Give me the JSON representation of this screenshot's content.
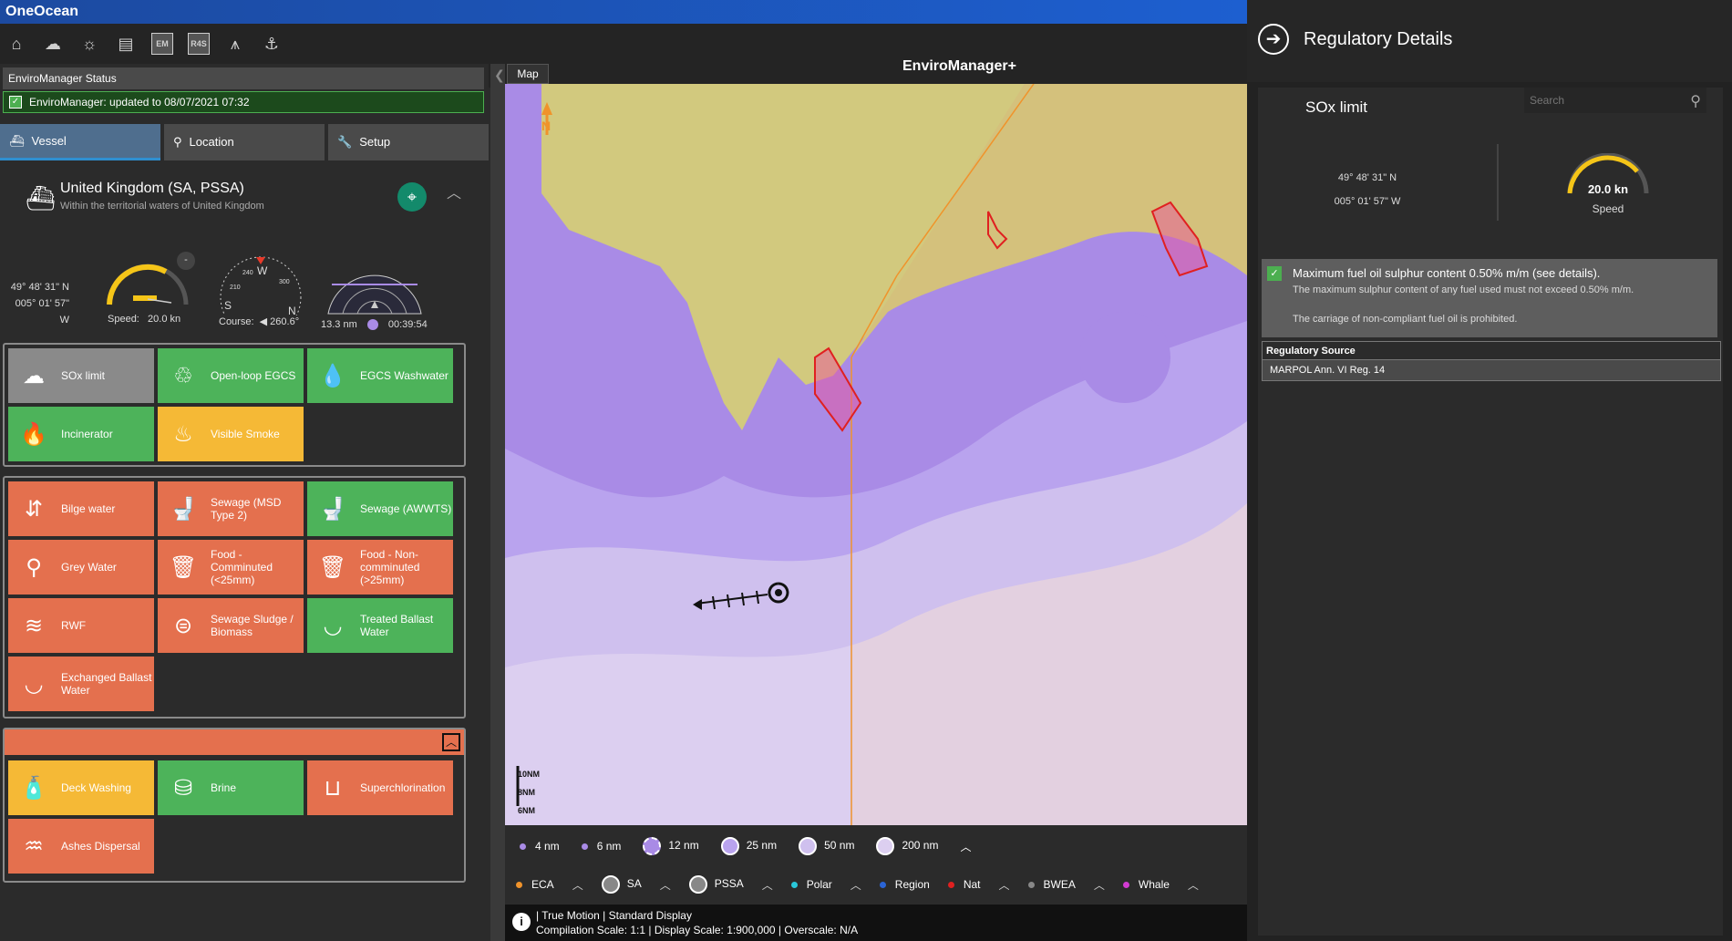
{
  "app_name": "OneOcean",
  "app_title": "EnviroManager+",
  "toolbar": {
    "icons": [
      "home-icon",
      "cloud-upload-icon",
      "weather-icon",
      "chart-icon",
      "em-icon",
      "r4s-icon",
      "compass-tool-icon",
      "anchor-icon"
    ],
    "em_label": "EM",
    "r4s_label": "R4S"
  },
  "status": {
    "header": "EnviroManager Status",
    "message": "EnviroManager: updated to 08/07/2021 07:32"
  },
  "tabs": [
    {
      "label": "Vessel"
    },
    {
      "label": "Location"
    },
    {
      "label": "Setup"
    }
  ],
  "location": {
    "name": "United Kingdom (SA, PSSA)",
    "subtitle": "Within the territorial waters of United Kingdom"
  },
  "position": {
    "lat": "49° 48' 31\" N",
    "lon": "005° 01' 57\" W"
  },
  "speed": {
    "label": "Speed:",
    "value": "20.0 kn",
    "minus": "-"
  },
  "course": {
    "label": "Course:",
    "value": "260.6°",
    "w": "W",
    "s": "S",
    "n": "N",
    "t240": "240",
    "t210": "210",
    "t300": "300"
  },
  "radar": {
    "distance": "13.3 nm",
    "time": "00:39:54"
  },
  "group1": [
    {
      "label": "SOx limit",
      "color": "gr",
      "icon": "sox-icon",
      "glyph": "☁"
    },
    {
      "label": "Open-loop EGCS",
      "color": "g",
      "icon": "egcs-icon",
      "glyph": "♲"
    },
    {
      "label": "EGCS Washwater",
      "color": "g",
      "icon": "drop-icon",
      "glyph": "💧"
    },
    {
      "label": "Incinerator",
      "color": "g",
      "icon": "flame-icon",
      "glyph": "🔥"
    },
    {
      "label": "Visible Smoke",
      "color": "y",
      "icon": "smoke-icon",
      "glyph": "♨"
    }
  ],
  "group2": [
    {
      "label": "Bilge water",
      "color": "o",
      "icon": "bilge-icon",
      "glyph": "⇵"
    },
    {
      "label": "Sewage (MSD Type 2)",
      "color": "o",
      "icon": "toilet-icon",
      "glyph": "🚽"
    },
    {
      "label": "Sewage (AWWTS)",
      "color": "g",
      "icon": "toilet-icon",
      "glyph": "🚽"
    },
    {
      "label": "Grey Water",
      "color": "o",
      "icon": "tap-icon",
      "glyph": "⚲"
    },
    {
      "label": "Food - Comminuted (<25mm)",
      "color": "o",
      "icon": "bin-icon",
      "glyph": "🗑"
    },
    {
      "label": "Food - Non-comminuted (>25mm)",
      "color": "o",
      "icon": "bin-icon",
      "glyph": "🗑"
    },
    {
      "label": "RWF",
      "color": "o",
      "icon": "waves-icon",
      "glyph": "≋"
    },
    {
      "label": "Sewage Sludge / Biomass",
      "color": "o",
      "icon": "sludge-icon",
      "glyph": "⊜"
    },
    {
      "label": "Treated Ballast Water",
      "color": "g",
      "icon": "ballast-icon",
      "glyph": "◡"
    },
    {
      "label": "Exchanged Ballast Water",
      "color": "o",
      "icon": "ballast-icon",
      "glyph": "◡"
    }
  ],
  "group3": [
    {
      "label": "Deck Washing",
      "color": "y",
      "icon": "deck-wash-icon",
      "glyph": "🧴"
    },
    {
      "label": "Brine",
      "color": "g",
      "icon": "brine-icon",
      "glyph": "⛁"
    },
    {
      "label": "Superchlorination",
      "color": "o",
      "icon": "pool-icon",
      "glyph": "⊔"
    },
    {
      "label": "Ashes Dispersal",
      "color": "o",
      "icon": "ashes-icon",
      "glyph": "♒"
    }
  ],
  "map": {
    "tab": "Map",
    "north": "N",
    "scale": [
      "10NM",
      "8NM",
      "6NM"
    ]
  },
  "legend1": [
    {
      "label": "4 nm"
    },
    {
      "label": "6 nm"
    },
    {
      "label": "12 nm"
    },
    {
      "label": "25 nm"
    },
    {
      "label": "50 nm"
    },
    {
      "label": "200 nm"
    }
  ],
  "legend2": [
    {
      "label": "ECA",
      "color": "#f0932b"
    },
    {
      "label": "SA",
      "color": "#888888"
    },
    {
      "label": "PSSA",
      "color": "#888888"
    },
    {
      "label": "Polar",
      "color": "#29c7d9"
    },
    {
      "label": "Region",
      "color": "#2a64d6"
    },
    {
      "label": "Nat",
      "color": "#e02020"
    },
    {
      "label": "BWEA",
      "color": "#888888"
    },
    {
      "label": "Whale",
      "color": "#d23bd2"
    }
  ],
  "info": {
    "line1": "| True Motion | Standard Display",
    "line2": "Compilation Scale: 1:1 | Display Scale: 1:900,000 | Overscale: N/A"
  },
  "right": {
    "title": "Regulatory Details",
    "subtitle": "SOx limit",
    "search_placeholder": "Search",
    "lat": "49° 48' 31\" N",
    "lon": "005° 01' 57\" W",
    "speed_value": "20.0 kn",
    "speed_label": "Speed",
    "rule_title": "Maximum fuel oil sulphur content 0.50% m/m (see details).",
    "rule_line1": "The maximum sulphur content of any fuel used must not exceed 0.50% m/m.",
    "rule_line2": "The carriage of non-compliant fuel oil is prohibited.",
    "source_header": "Regulatory Source",
    "source_value": "MARPOL Ann. VI Reg. 14"
  }
}
